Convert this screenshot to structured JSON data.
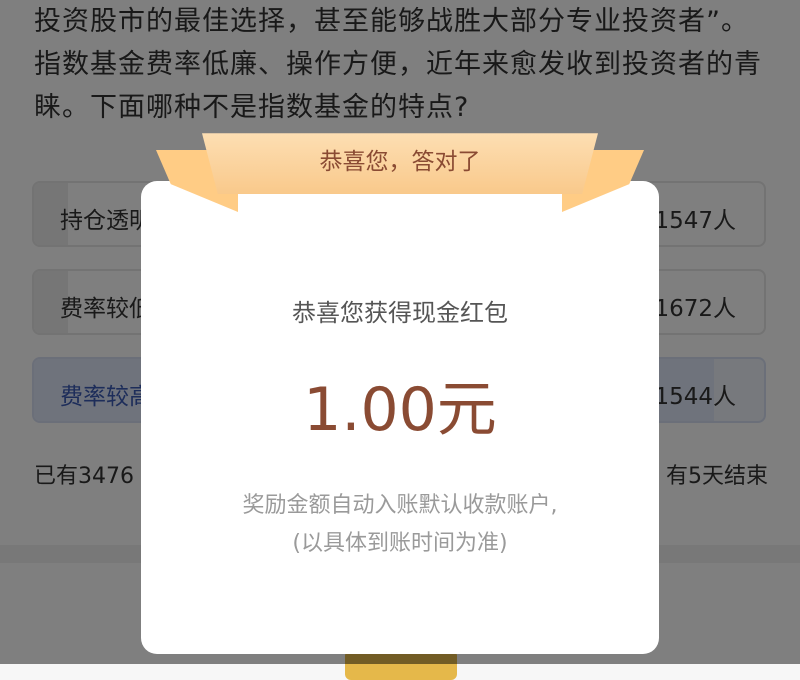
{
  "question": {
    "text": "投资股市的最佳选择，甚至能够战胜大部分专业投资者”。指数基金费率低廉、操作方便，近年来愈发收到投资者的青睐。下面哪种不是指数基金的特点?"
  },
  "options": [
    {
      "label": "持仓透明",
      "count": "1547人",
      "progress": 0.05
    },
    {
      "label": "费率较低",
      "count": "1672人",
      "progress": 0.05
    },
    {
      "label": "费率较高",
      "count": "1544人",
      "progress": 0.93,
      "selected": true
    }
  ],
  "status": {
    "left": "已有3476",
    "right": "有5天结束"
  },
  "modal": {
    "banner": "恭喜您，答对了",
    "title": "恭喜您获得现金红包",
    "amount": "1.00元",
    "note_line1": "奖励金额自动入账默认收款账户,",
    "note_line2": "(以具体到账时间为准)"
  },
  "colors": {
    "accent_brown": "#8a4b33",
    "ribbon": "#f9c98b",
    "selected_blue": "#3b5bb5"
  }
}
